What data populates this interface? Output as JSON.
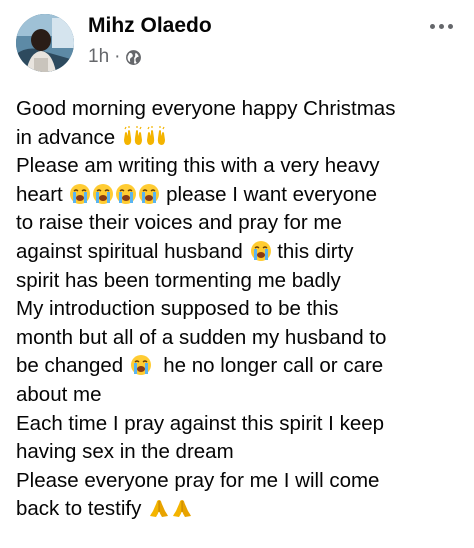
{
  "post": {
    "author": "Mihz Olaedo",
    "time": "1h",
    "separator": "·",
    "audience_icon": "globe-icon",
    "more_icon": "more-options-icon",
    "lines": [
      "Good morning everyone happy Christmas",
      "in advance",
      "Please am writing this with a very heavy",
      "heart",
      "please I want everyone",
      "to raise their voices and pray for me",
      "against spiritual husband",
      "this dirty",
      "spirit has been tormenting me badly",
      "My introduction supposed to be this",
      "month but all of a sudden my husband to",
      "be changed",
      "he no longer call or care",
      "about me",
      "Each time I pray against this spirit I keep",
      "having sex in the dream",
      "Please everyone pray for me I will come",
      "back to testify"
    ],
    "emojis": {
      "raising_hands": "raising-hands-emoji",
      "crying_face": "loudly-crying-face-emoji",
      "folded_hands": "folded-hands-emoji"
    }
  },
  "colors": {
    "text": "#050505",
    "secondary": "#65676b",
    "background": "#ffffff"
  }
}
